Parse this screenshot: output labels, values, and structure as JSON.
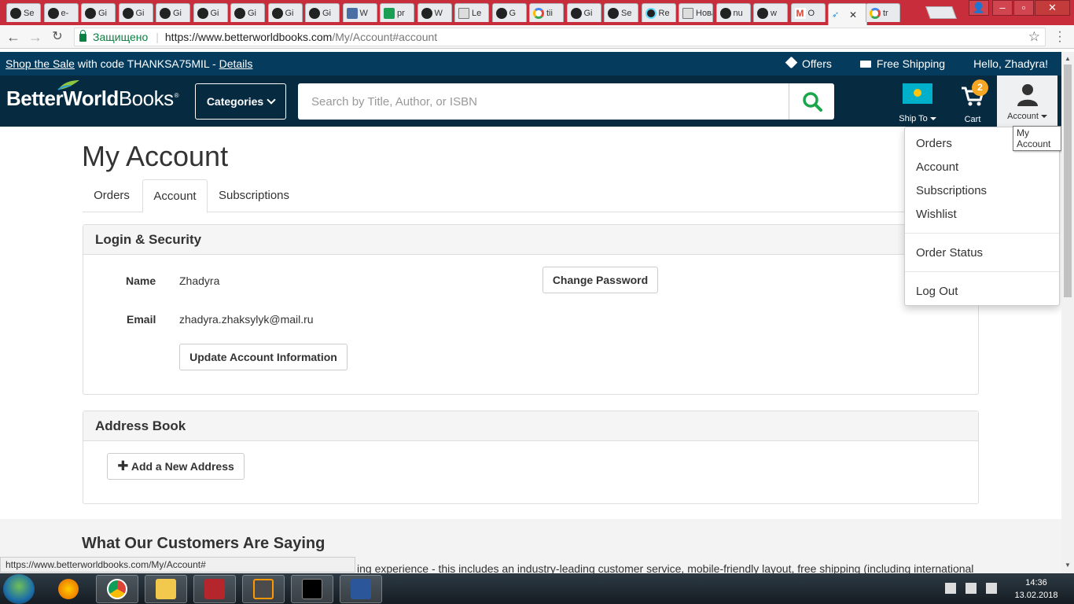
{
  "browser": {
    "tabs": [
      {
        "label": "Se",
        "icon": "github-icon"
      },
      {
        "label": "e-",
        "icon": "github-icon"
      },
      {
        "label": "Gi",
        "icon": "github-icon"
      },
      {
        "label": "Gi",
        "icon": "github-icon"
      },
      {
        "label": "Gi",
        "icon": "github-icon"
      },
      {
        "label": "Gi",
        "icon": "github-icon"
      },
      {
        "label": "Gi",
        "icon": "github-icon"
      },
      {
        "label": "Gi",
        "icon": "github-icon"
      },
      {
        "label": "Gi",
        "icon": "github-icon"
      },
      {
        "label": "W",
        "icon": "p-icon"
      },
      {
        "label": "pr",
        "icon": "sheets-icon"
      },
      {
        "label": "W",
        "icon": "github-icon"
      },
      {
        "label": "Le",
        "icon": "doc-icon"
      },
      {
        "label": "G",
        "icon": "github-icon"
      },
      {
        "label": "tii",
        "icon": "google-icon"
      },
      {
        "label": "Gi",
        "icon": "github-icon"
      },
      {
        "label": "Se",
        "icon": "github-icon"
      },
      {
        "label": "Re",
        "icon": "react-icon"
      },
      {
        "label": "Нова",
        "icon": "blank-icon"
      },
      {
        "label": "nu",
        "icon": "github-icon"
      },
      {
        "label": "w",
        "icon": "github-icon"
      },
      {
        "label": "O",
        "icon": "gmail-icon"
      },
      {
        "label": "",
        "icon": "betterworldbooks-icon",
        "active": true
      },
      {
        "label": "tr",
        "icon": "google-icon"
      }
    ],
    "secure_label": "Защищено",
    "url_host": "https://www.betterworldbooks.com",
    "url_path": "/My/Account#account",
    "status_url": "https://www.betterworldbooks.com/My/Account#"
  },
  "promo": {
    "sale_link": "Shop the Sale",
    "sale_text": " with code THANKSA75MIL - ",
    "details_link": "Details",
    "offers": "Offers",
    "free_shipping": "Free Shipping",
    "greeting": "Hello, Zhadyra!"
  },
  "header": {
    "logo_part1": "Better",
    "logo_part2": "World",
    "logo_part3": "Books",
    "logo_reg": "®",
    "categories_label": "Categories",
    "search_placeholder": "Search by Title, Author, or ISBN",
    "ship_to": "Ship To",
    "cart_label": "Cart",
    "cart_count": "2",
    "account_label": "Account",
    "account_tooltip": "My Account"
  },
  "account_menu": {
    "items": [
      "Orders",
      "Account",
      "Subscriptions",
      "Wishlist"
    ],
    "order_status": "Order Status",
    "logout": "Log Out"
  },
  "main": {
    "title": "My Account",
    "tabs": [
      "Orders",
      "Account",
      "Subscriptions"
    ],
    "active_tab": "Account",
    "login_security": {
      "heading": "Login & Security",
      "name_label": "Name",
      "name_value": "Zhadyra",
      "email_label": "Email",
      "email_value": "zhadyra.zhaksylyk@mail.ru",
      "change_password": "Change Password",
      "update_info": "Update Account Information"
    },
    "address_book": {
      "heading": "Address Book",
      "add_address": "Add a New Address"
    },
    "customers": {
      "heading": "What Our Customers Are Saying",
      "text": "ing experience - this includes an industry-leading customer service, mobile-friendly layout, free shipping (including international"
    }
  },
  "taskbar": {
    "time": "14:36",
    "date": "13.02.2018"
  },
  "colors": {
    "promo_bg": "#053c5e",
    "header_bg": "#062a40",
    "search_green": "#1aa64a",
    "badge_orange": "#f5a623",
    "tab_strip": "#c72d3a"
  }
}
